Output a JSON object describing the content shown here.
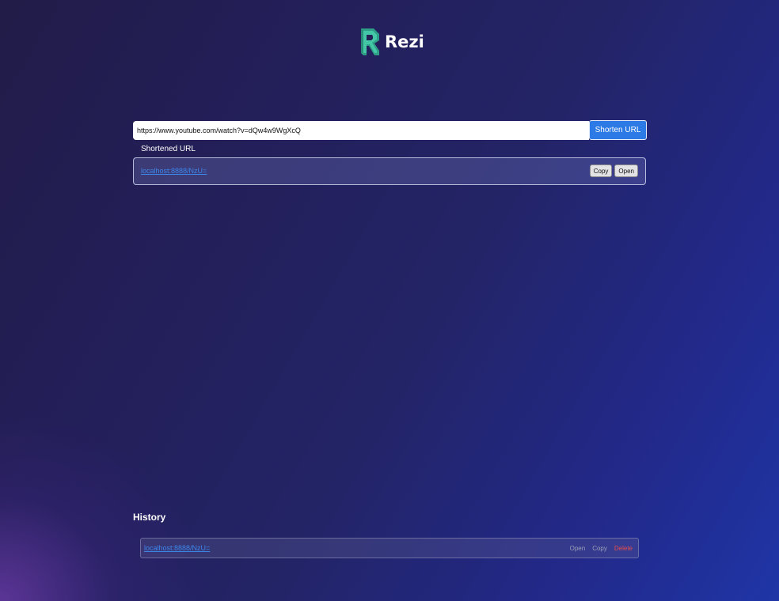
{
  "app": {
    "name": "Rezi",
    "brand_color": "#3dbf9f",
    "accent_color": "#2c7ae6",
    "danger_color": "#e84c4c"
  },
  "shortener": {
    "input_value": "https://www.youtube.com/watch?v=dQw4w9WgXcQ",
    "shorten_label": "Shorten URL",
    "result_label": "Shortened URL",
    "result_link": "localhost:8888/NzU=",
    "copy_label": "Copy",
    "open_label": "Open"
  },
  "history": {
    "title": "History",
    "items": [
      {
        "link": "localhost:8888/NzU=",
        "open_label": "Open",
        "copy_label": "Copy",
        "delete_label": "Delete"
      }
    ]
  },
  "icons": {
    "logo": "rezi-logo-icon"
  }
}
